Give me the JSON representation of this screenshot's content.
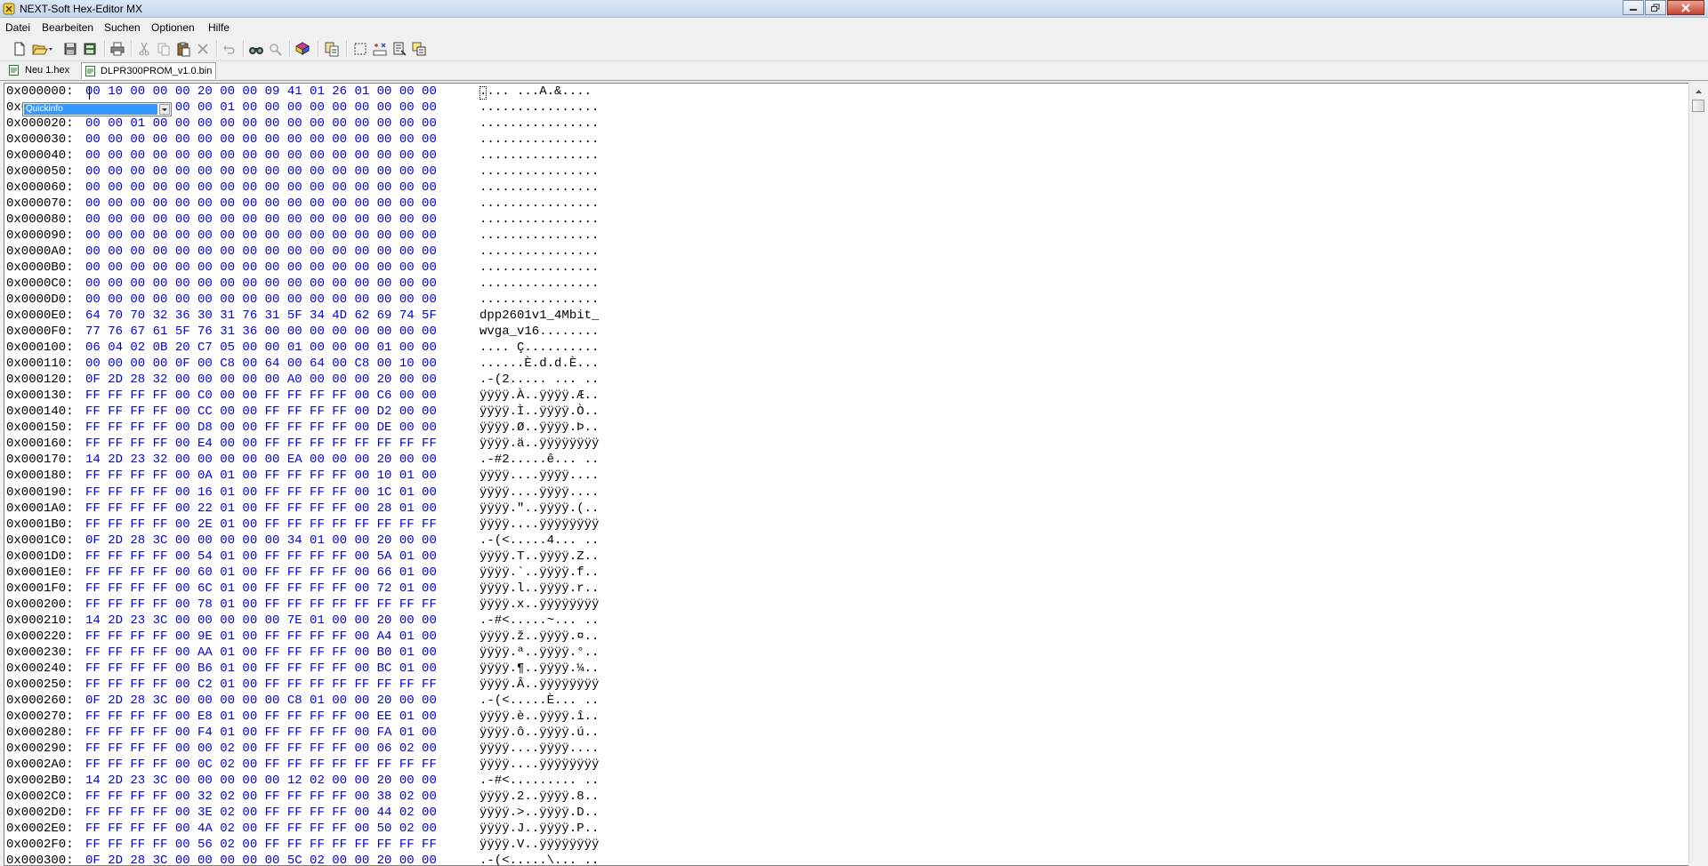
{
  "window": {
    "title": "NEXT-Soft Hex-Editor MX"
  },
  "menu": [
    {
      "id": "datei",
      "label": "Datei"
    },
    {
      "id": "bearbeiten",
      "label": "Bearbeiten"
    },
    {
      "id": "suchen",
      "label": "Suchen"
    },
    {
      "id": "optionen",
      "label": "Optionen"
    },
    {
      "id": "hilfe",
      "label": "Hilfe"
    }
  ],
  "toolbar": [
    "new-file-icon",
    "open-file-icon",
    "save-icon",
    "save-all-icon",
    "print-icon",
    "cut-icon",
    "copy-icon",
    "paste-icon",
    "delete-icon",
    "undo-icon",
    "find-icon",
    "replace-icon",
    "bookmark-book-icon",
    "compare-icon",
    "select-block-icon",
    "hex-convert-icon",
    "export-icon",
    "properties-icon"
  ],
  "tabs": [
    {
      "label": "Neu 1.hex",
      "active": false
    },
    {
      "label": "DLPR300PROM_v1.0.bin",
      "active": true
    }
  ],
  "quickinfo": {
    "label": "Quickinfo"
  },
  "hex_rows": [
    {
      "offset": "0x000000:",
      "bytes": "00 10 00 00 00 20 00 00 09 41 01 26 01 00 00 00",
      "ascii": ".... ...A.&...."
    },
    {
      "offset": "0x000010:",
      "bytes": "00 00 00 00 00 00 01 00 00 00 00 00 00 00 00 00",
      "ascii": "................"
    },
    {
      "offset": "0x000020:",
      "bytes": "00 00 01 00 00 00 00 00 00 00 00 00 00 00 00 00",
      "ascii": "................"
    },
    {
      "offset": "0x000030:",
      "bytes": "00 00 00 00 00 00 00 00 00 00 00 00 00 00 00 00",
      "ascii": "................"
    },
    {
      "offset": "0x000040:",
      "bytes": "00 00 00 00 00 00 00 00 00 00 00 00 00 00 00 00",
      "ascii": "................"
    },
    {
      "offset": "0x000050:",
      "bytes": "00 00 00 00 00 00 00 00 00 00 00 00 00 00 00 00",
      "ascii": "................"
    },
    {
      "offset": "0x000060:",
      "bytes": "00 00 00 00 00 00 00 00 00 00 00 00 00 00 00 00",
      "ascii": "................"
    },
    {
      "offset": "0x000070:",
      "bytes": "00 00 00 00 00 00 00 00 00 00 00 00 00 00 00 00",
      "ascii": "................"
    },
    {
      "offset": "0x000080:",
      "bytes": "00 00 00 00 00 00 00 00 00 00 00 00 00 00 00 00",
      "ascii": "................"
    },
    {
      "offset": "0x000090:",
      "bytes": "00 00 00 00 00 00 00 00 00 00 00 00 00 00 00 00",
      "ascii": "................"
    },
    {
      "offset": "0x0000A0:",
      "bytes": "00 00 00 00 00 00 00 00 00 00 00 00 00 00 00 00",
      "ascii": "................"
    },
    {
      "offset": "0x0000B0:",
      "bytes": "00 00 00 00 00 00 00 00 00 00 00 00 00 00 00 00",
      "ascii": "................"
    },
    {
      "offset": "0x0000C0:",
      "bytes": "00 00 00 00 00 00 00 00 00 00 00 00 00 00 00 00",
      "ascii": "................"
    },
    {
      "offset": "0x0000D0:",
      "bytes": "00 00 00 00 00 00 00 00 00 00 00 00 00 00 00 00",
      "ascii": "................"
    },
    {
      "offset": "0x0000E0:",
      "bytes": "64 70 70 32 36 30 31 76 31 5F 34 4D 62 69 74 5F",
      "ascii": "dpp2601v1_4Mbit_"
    },
    {
      "offset": "0x0000F0:",
      "bytes": "77 76 67 61 5F 76 31 36 00 00 00 00 00 00 00 00",
      "ascii": "wvga_v16........"
    },
    {
      "offset": "0x000100:",
      "bytes": "06 04 02 0B 20 C7 05 00 00 01 00 00 00 01 00 00",
      "ascii": ".... Ç.........."
    },
    {
      "offset": "0x000110:",
      "bytes": "00 00 00 00 0F 00 C8 00 64 00 64 00 C8 00 10 00",
      "ascii": "......È.d.d.È..."
    },
    {
      "offset": "0x000120:",
      "bytes": "0F 2D 28 32 00 00 00 00 00 A0 00 00 00 20 00 00",
      "ascii": ".-(2..... ... .."
    },
    {
      "offset": "0x000130:",
      "bytes": "FF FF FF FF 00 C0 00 00 FF FF FF FF 00 C6 00 00",
      "ascii": "ÿÿÿÿ.À..ÿÿÿÿ.Æ.."
    },
    {
      "offset": "0x000140:",
      "bytes": "FF FF FF FF 00 CC 00 00 FF FF FF FF 00 D2 00 00",
      "ascii": "ÿÿÿÿ.Ì..ÿÿÿÿ.Ò.."
    },
    {
      "offset": "0x000150:",
      "bytes": "FF FF FF FF 00 D8 00 00 FF FF FF FF 00 DE 00 00",
      "ascii": "ÿÿÿÿ.Ø..ÿÿÿÿ.Þ.."
    },
    {
      "offset": "0x000160:",
      "bytes": "FF FF FF FF 00 E4 00 00 FF FF FF FF FF FF FF FF",
      "ascii": "ÿÿÿÿ.ä..ÿÿÿÿÿÿÿÿ"
    },
    {
      "offset": "0x000170:",
      "bytes": "14 2D 23 32 00 00 00 00 00 EA 00 00 00 20 00 00",
      "ascii": ".-#2.....ê... .."
    },
    {
      "offset": "0x000180:",
      "bytes": "FF FF FF FF 00 0A 01 00 FF FF FF FF 00 10 01 00",
      "ascii": "ÿÿÿÿ....ÿÿÿÿ...."
    },
    {
      "offset": "0x000190:",
      "bytes": "FF FF FF FF 00 16 01 00 FF FF FF FF 00 1C 01 00",
      "ascii": "ÿÿÿÿ....ÿÿÿÿ...."
    },
    {
      "offset": "0x0001A0:",
      "bytes": "FF FF FF FF 00 22 01 00 FF FF FF FF 00 28 01 00",
      "ascii": "ÿÿÿÿ.\"..ÿÿÿÿ.(.."
    },
    {
      "offset": "0x0001B0:",
      "bytes": "FF FF FF FF 00 2E 01 00 FF FF FF FF FF FF FF FF",
      "ascii": "ÿÿÿÿ....ÿÿÿÿÿÿÿÿ"
    },
    {
      "offset": "0x0001C0:",
      "bytes": "0F 2D 28 3C 00 00 00 00 00 34 01 00 00 20 00 00",
      "ascii": ".-(<.....4... .."
    },
    {
      "offset": "0x0001D0:",
      "bytes": "FF FF FF FF 00 54 01 00 FF FF FF FF 00 5A 01 00",
      "ascii": "ÿÿÿÿ.T..ÿÿÿÿ.Z.."
    },
    {
      "offset": "0x0001E0:",
      "bytes": "FF FF FF FF 00 60 01 00 FF FF FF FF 00 66 01 00",
      "ascii": "ÿÿÿÿ.`..ÿÿÿÿ.f.."
    },
    {
      "offset": "0x0001F0:",
      "bytes": "FF FF FF FF 00 6C 01 00 FF FF FF FF 00 72 01 00",
      "ascii": "ÿÿÿÿ.l..ÿÿÿÿ.r.."
    },
    {
      "offset": "0x000200:",
      "bytes": "FF FF FF FF 00 78 01 00 FF FF FF FF FF FF FF FF",
      "ascii": "ÿÿÿÿ.x..ÿÿÿÿÿÿÿÿ"
    },
    {
      "offset": "0x000210:",
      "bytes": "14 2D 23 3C 00 00 00 00 00 7E 01 00 00 20 00 00",
      "ascii": ".-#<.....~... .."
    },
    {
      "offset": "0x000220:",
      "bytes": "FF FF FF FF 00 9E 01 00 FF FF FF FF 00 A4 01 00",
      "ascii": "ÿÿÿÿ.ž..ÿÿÿÿ.¤.."
    },
    {
      "offset": "0x000230:",
      "bytes": "FF FF FF FF 00 AA 01 00 FF FF FF FF 00 B0 01 00",
      "ascii": "ÿÿÿÿ.ª..ÿÿÿÿ.°.."
    },
    {
      "offset": "0x000240:",
      "bytes": "FF FF FF FF 00 B6 01 00 FF FF FF FF 00 BC 01 00",
      "ascii": "ÿÿÿÿ.¶..ÿÿÿÿ.¼.."
    },
    {
      "offset": "0x000250:",
      "bytes": "FF FF FF FF 00 C2 01 00 FF FF FF FF FF FF FF FF",
      "ascii": "ÿÿÿÿ.Â..ÿÿÿÿÿÿÿÿ"
    },
    {
      "offset": "0x000260:",
      "bytes": "0F 2D 28 3C 00 00 00 00 00 C8 01 00 00 20 00 00",
      "ascii": ".-(<.....È... .."
    },
    {
      "offset": "0x000270:",
      "bytes": "FF FF FF FF 00 E8 01 00 FF FF FF FF 00 EE 01 00",
      "ascii": "ÿÿÿÿ.è..ÿÿÿÿ.î.."
    },
    {
      "offset": "0x000280:",
      "bytes": "FF FF FF FF 00 F4 01 00 FF FF FF FF 00 FA 01 00",
      "ascii": "ÿÿÿÿ.ô..ÿÿÿÿ.ú.."
    },
    {
      "offset": "0x000290:",
      "bytes": "FF FF FF FF 00 00 02 00 FF FF FF FF 00 06 02 00",
      "ascii": "ÿÿÿÿ....ÿÿÿÿ...."
    },
    {
      "offset": "0x0002A0:",
      "bytes": "FF FF FF FF 00 0C 02 00 FF FF FF FF FF FF FF FF",
      "ascii": "ÿÿÿÿ....ÿÿÿÿÿÿÿÿ"
    },
    {
      "offset": "0x0002B0:",
      "bytes": "14 2D 23 3C 00 00 00 00 00 12 02 00 00 20 00 00",
      "ascii": ".-#<......... .."
    },
    {
      "offset": "0x0002C0:",
      "bytes": "FF FF FF FF 00 32 02 00 FF FF FF FF 00 38 02 00",
      "ascii": "ÿÿÿÿ.2..ÿÿÿÿ.8.."
    },
    {
      "offset": "0x0002D0:",
      "bytes": "FF FF FF FF 00 3E 02 00 FF FF FF FF 00 44 02 00",
      "ascii": "ÿÿÿÿ.>..ÿÿÿÿ.D.."
    },
    {
      "offset": "0x0002E0:",
      "bytes": "FF FF FF FF 00 4A 02 00 FF FF FF FF 00 50 02 00",
      "ascii": "ÿÿÿÿ.J..ÿÿÿÿ.P.."
    },
    {
      "offset": "0x0002F0:",
      "bytes": "FF FF FF FF 00 56 02 00 FF FF FF FF FF FF FF FF",
      "ascii": "ÿÿÿÿ.V..ÿÿÿÿÿÿÿÿ"
    },
    {
      "offset": "0x000300:",
      "bytes": "0F 2D 28 3C 00 00 00 00 00 5C 02 00 00 20 00 00",
      "ascii": ".-(<.....\\... .."
    }
  ],
  "colors": {
    "hex_bytes": "#0000dd",
    "selection": "#3399ff",
    "editor_bg": "#ffffff"
  }
}
